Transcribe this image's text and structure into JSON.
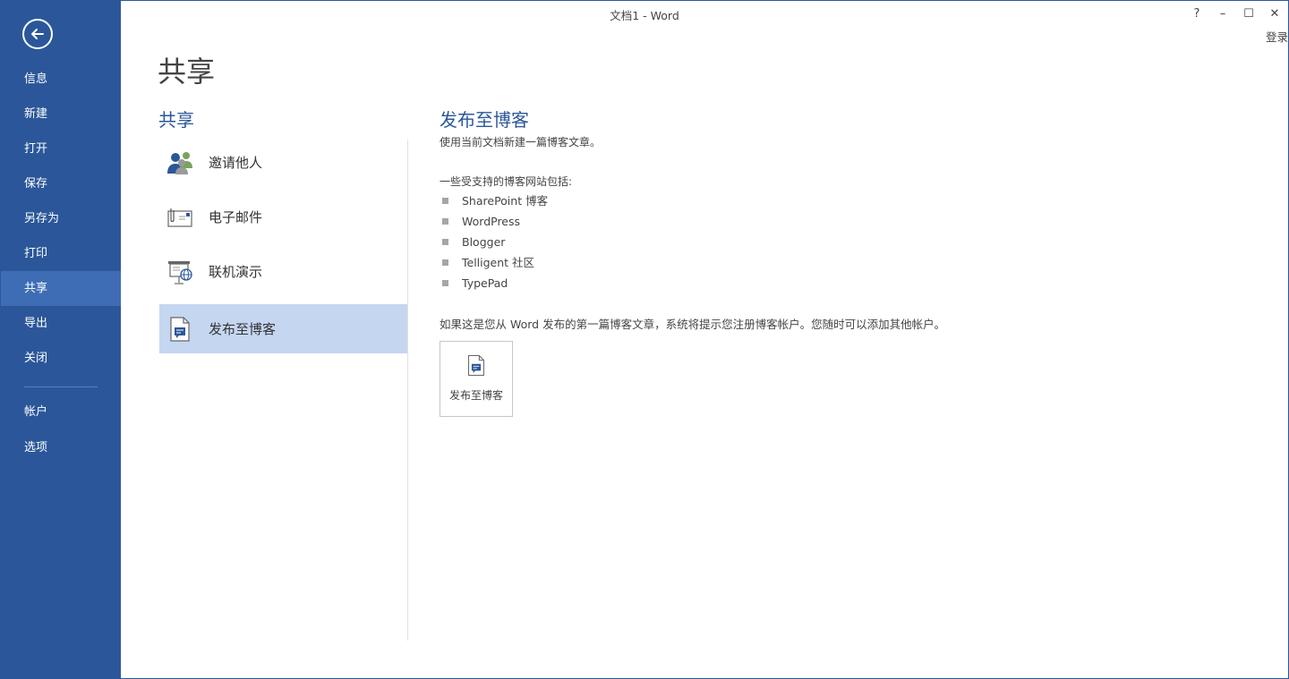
{
  "window": {
    "title": "文档1 - Word",
    "help_label": "?",
    "minimize_label": "–",
    "maximize_label": "☐",
    "close_label": "✕",
    "signin_label": "登录"
  },
  "sidebar": {
    "items": [
      {
        "label": "信息"
      },
      {
        "label": "新建"
      },
      {
        "label": "打开"
      },
      {
        "label": "保存"
      },
      {
        "label": "另存为"
      },
      {
        "label": "打印"
      },
      {
        "label": "共享"
      },
      {
        "label": "导出"
      },
      {
        "label": "关闭"
      }
    ],
    "bottom_items": [
      {
        "label": "帐户"
      },
      {
        "label": "选项"
      }
    ],
    "active": "共享"
  },
  "page": {
    "title": "共享",
    "section_title": "共享",
    "options": [
      {
        "label": "邀请他人",
        "icon": "people-icon"
      },
      {
        "label": "电子邮件",
        "icon": "email-icon"
      },
      {
        "label": "联机演示",
        "icon": "online-presentation-icon"
      },
      {
        "label": "发布至博客",
        "icon": "blog-icon"
      }
    ],
    "selected_option": "发布至博客"
  },
  "detail": {
    "title": "发布至博客",
    "description": "使用当前文档新建一篇博客文章。",
    "sites_heading": "一些受支持的博客网站包括:",
    "sites": [
      "SharePoint 博客",
      "WordPress",
      "Blogger",
      "Telligent 社区",
      "TypePad"
    ],
    "note": "如果这是您从 Word 发布的第一篇博客文章，系统将提示您注册博客帐户。您随时可以添加其他帐户。",
    "publish_button_label": "发布至博客"
  },
  "colors": {
    "accent": "#2b579a",
    "sidebar_active": "#3e6db5",
    "selected_option": "#c5d6f1"
  }
}
